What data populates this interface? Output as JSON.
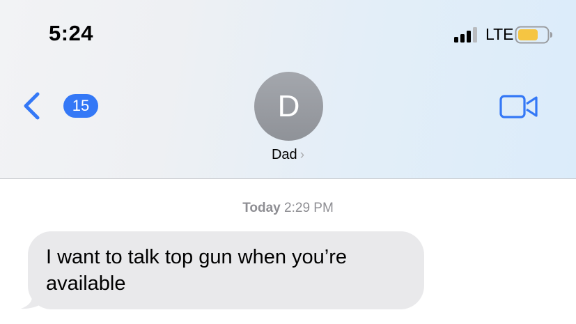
{
  "status_bar": {
    "time": "5:24",
    "network": "LTE",
    "signal_bars_filled": 3,
    "signal_bars_total": 4,
    "battery_level_approx": 0.6,
    "battery_color": "#f5c542"
  },
  "nav": {
    "back_count": "15",
    "contact_initial": "D",
    "contact_name": "Dad",
    "chevron": "›",
    "accent_color": "#3478f6"
  },
  "conversation": {
    "timestamp_day": "Today",
    "timestamp_time": "2:29 PM",
    "messages": [
      {
        "direction": "incoming",
        "text": "I want to talk top gun when you’re available"
      }
    ]
  }
}
